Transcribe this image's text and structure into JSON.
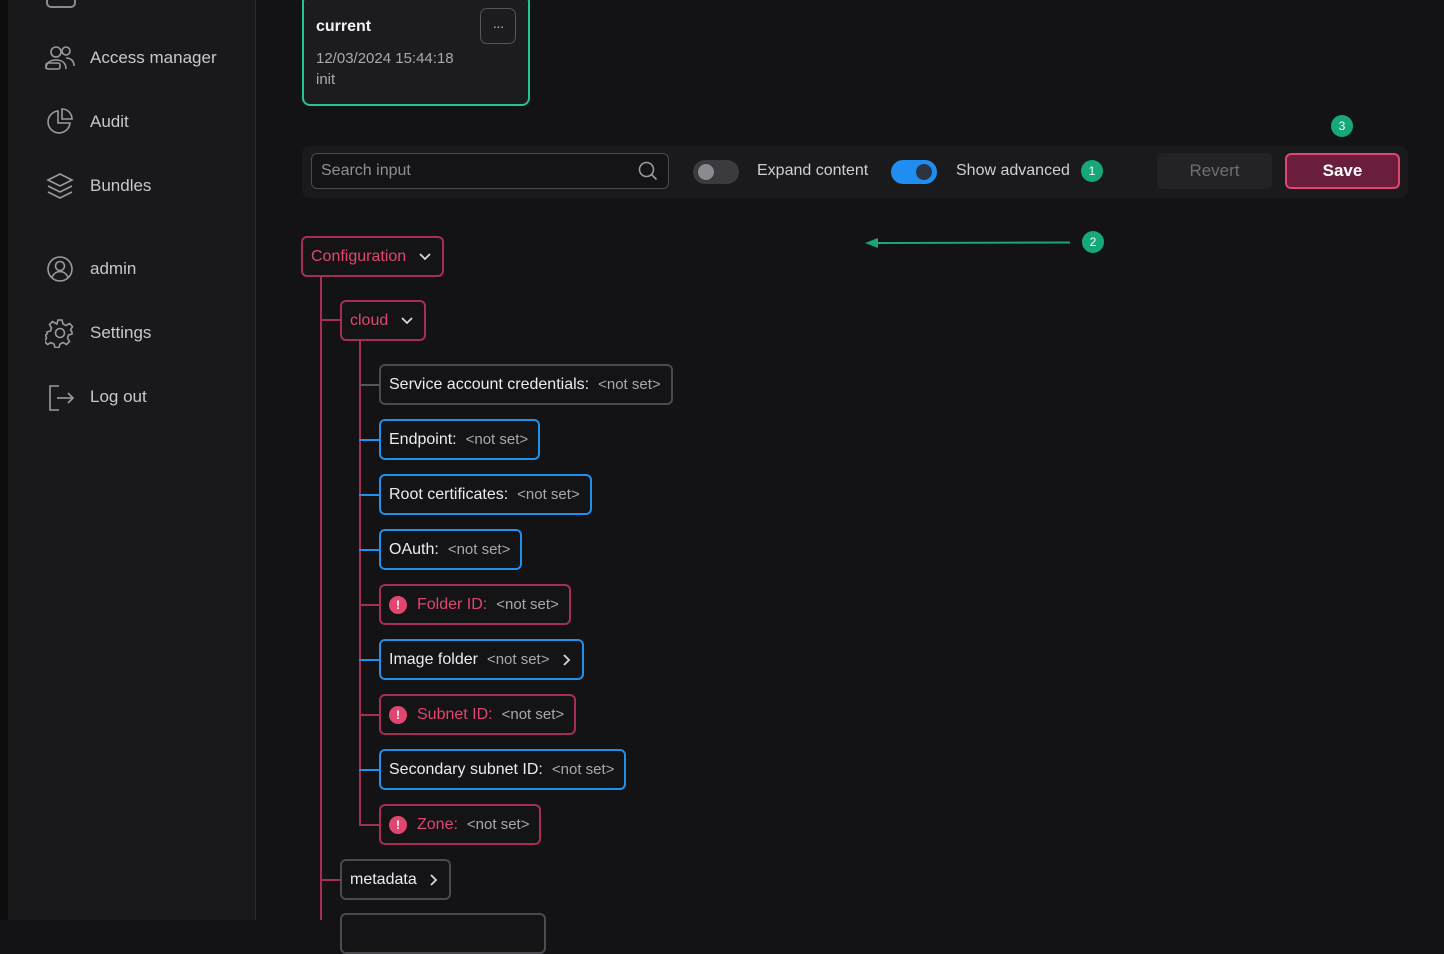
{
  "sidebar": {
    "items": [
      {
        "label": "Access manager",
        "icon": "users-icon"
      },
      {
        "label": "Audit",
        "icon": "pie-chart-icon"
      },
      {
        "label": "Bundles",
        "icon": "layers-icon"
      },
      {
        "label": "admin",
        "icon": "user-circle-icon"
      },
      {
        "label": "Settings",
        "icon": "gear-icon"
      },
      {
        "label": "Log out",
        "icon": "logout-icon"
      }
    ]
  },
  "version_card": {
    "title": "current",
    "menu_label": "···",
    "date": "12/03/2024 15:44:18",
    "description": "init"
  },
  "toolbar": {
    "search_placeholder": "Search input",
    "expand_content_label": "Expand content",
    "expand_content_on": false,
    "show_advanced_label": "Show advanced",
    "show_advanced_on": true,
    "revert_label": "Revert",
    "save_label": "Save"
  },
  "badges": {
    "one": "1",
    "two": "2",
    "three": "3"
  },
  "tree": {
    "root": "Configuration",
    "cloud": "cloud",
    "fields": [
      {
        "label": "Service account credentials:",
        "value": "<not set>"
      },
      {
        "label": "Endpoint:",
        "value": "<not set>"
      },
      {
        "label": "Root certificates:",
        "value": "<not set>"
      },
      {
        "label": "OAuth:",
        "value": "<not set>"
      },
      {
        "label": "Folder ID:",
        "value": "<not set>"
      },
      {
        "label": "Image folder",
        "value": "<not set>"
      },
      {
        "label": "Subnet ID:",
        "value": "<not set>"
      },
      {
        "label": "Secondary subnet ID:",
        "value": "<not set>"
      },
      {
        "label": "Zone:",
        "value": "<not set>"
      }
    ],
    "metadata": "metadata"
  },
  "colors": {
    "accent_green": "#27c392",
    "accent_red": "#e0466f",
    "accent_blue": "#2290ea",
    "background": "#131315"
  }
}
